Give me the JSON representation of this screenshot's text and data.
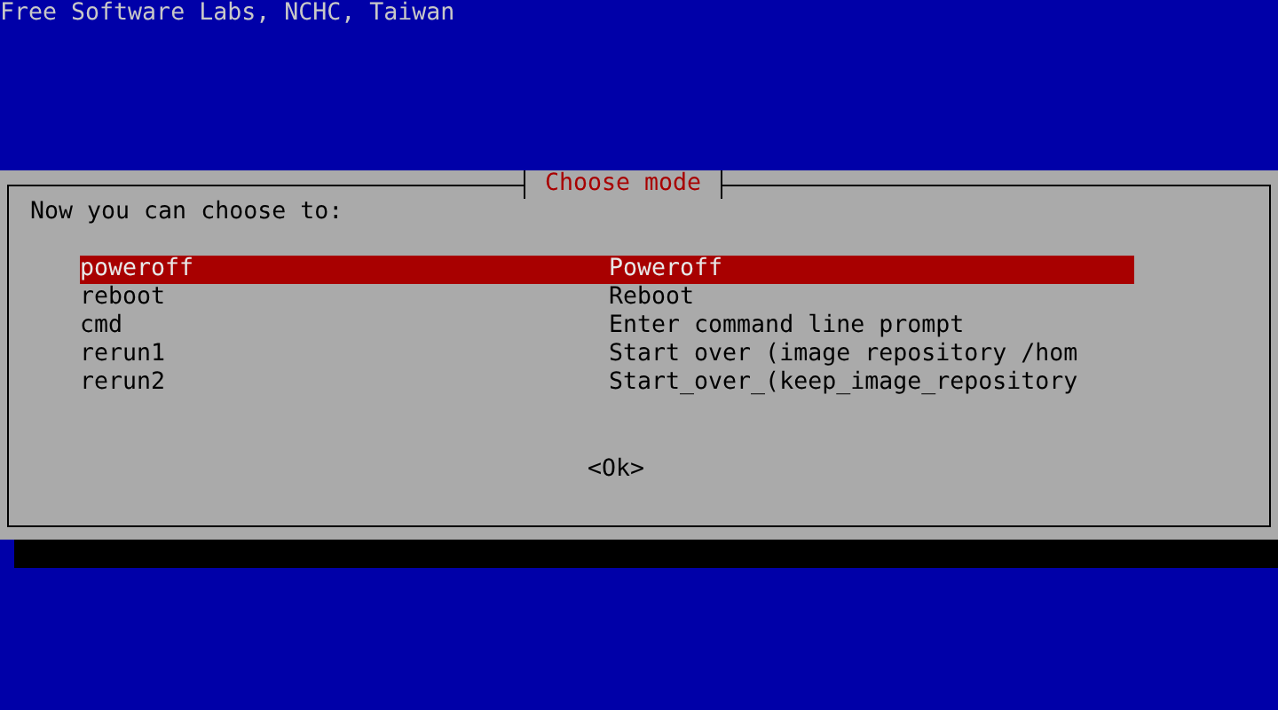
{
  "backtitle": "Free Software Labs, NCHC, Taiwan",
  "dialog": {
    "title": "Choose mode",
    "prompt": "Now you can choose to:",
    "items": [
      {
        "tag": "poweroff",
        "description": "Poweroff",
        "selected": true
      },
      {
        "tag": "reboot",
        "description": "Reboot",
        "selected": false
      },
      {
        "tag": "cmd",
        "description": "Enter command line prompt",
        "selected": false
      },
      {
        "tag": "rerun1",
        "description": "Start over (image repository /hom",
        "selected": false
      },
      {
        "tag": "rerun2",
        "description": "Start_over_(keep_image_repository",
        "selected": false
      }
    ],
    "button": {
      "label": "<Ok>"
    }
  }
}
